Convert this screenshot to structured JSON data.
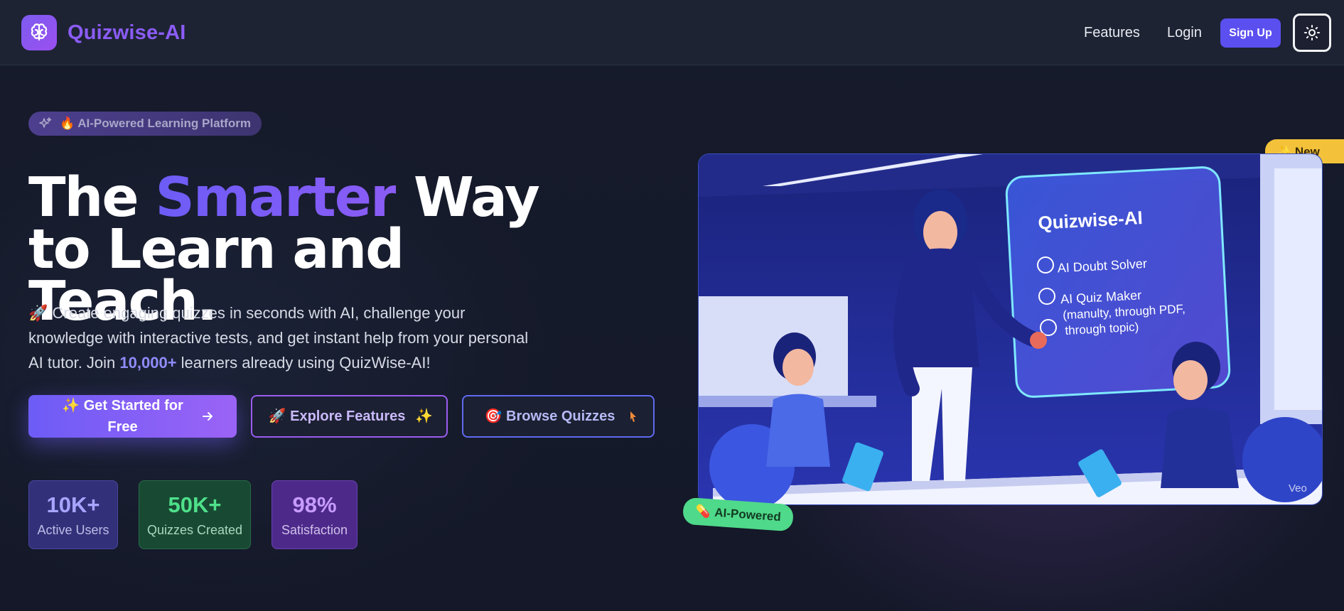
{
  "nav": {
    "brand": "Quizwise-AI",
    "features": "Features",
    "login": "Login",
    "signup": "Sign Up"
  },
  "hero": {
    "badge": "🔥 AI-Powered Learning Platform",
    "headline_pre": "The ",
    "headline_accent": "Smarter",
    "headline_post": " Way to Learn and Teach.",
    "desc_pre": "🚀 Create engaging quizzes in seconds with AI, challenge your knowledge with interactive tests, and get instant help from your personal AI tutor. Join ",
    "desc_highlight": "10,000+",
    "desc_post": " learners already using QuizWise-AI!",
    "cta_primary": "✨ Get Started for Free",
    "cta_explore": "🚀 Explore Features",
    "cta_browse": "🎯 Browse Quizzes"
  },
  "stats": [
    {
      "value": "10K+",
      "label": "Active Users"
    },
    {
      "value": "50K+",
      "label": "Quizzes Created"
    },
    {
      "value": "98%",
      "label": "Satisfaction"
    }
  ],
  "image": {
    "new_tag": "✨ New",
    "screen_title": "Quizwise-AI",
    "screen_item1": "AI Doubt Solver",
    "screen_item2": "AI Quiz Maker",
    "screen_item2_sub1": "(manulty, through PDF,",
    "screen_item2_sub2": "through topic)",
    "watermark": "Veo",
    "ai_pill": "AI-Powered"
  },
  "colors": {
    "accent": "#8b5cf6",
    "signup": "#5b4ff0",
    "stat_green": "#4ee08a"
  }
}
